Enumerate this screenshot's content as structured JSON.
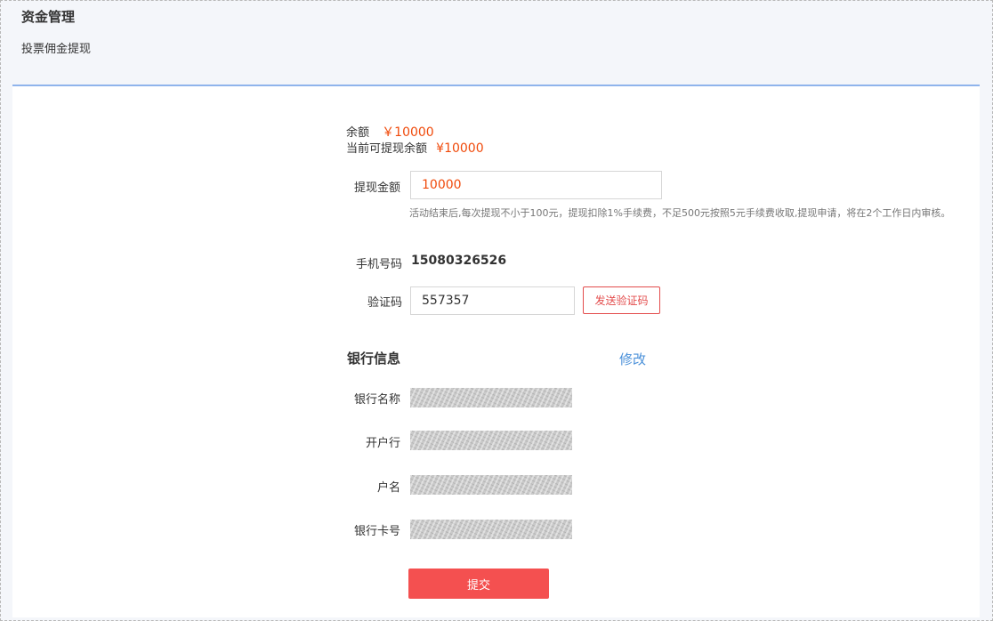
{
  "header": {
    "title": "资金管理",
    "subtitle": "投票佣金提现"
  },
  "balance": {
    "label": "余额",
    "value": "￥10000"
  },
  "available": {
    "label": "当前可提现余额",
    "value": "¥10000"
  },
  "withdraw": {
    "label": "提现金额",
    "value": "10000",
    "hint": "活动结束后,每次提现不小于100元，提现扣除1%手续费，不足500元按照5元手续费收取,提现申请，将在2个工作日内审核。"
  },
  "phone": {
    "label": "手机号码",
    "value": "15080326526"
  },
  "code": {
    "label": "验证码",
    "value": "557357",
    "send_label": "发送验证码"
  },
  "bank": {
    "section_title": "银行信息",
    "edit_label": "修改",
    "fields": [
      {
        "label": "银行名称"
      },
      {
        "label": "开户行"
      },
      {
        "label": "户名"
      },
      {
        "label": "银行卡号"
      }
    ]
  },
  "submit_label": "提交",
  "colors": {
    "accent_red": "#f04a0b",
    "button_red": "#f45050",
    "link_blue": "#4a90d9",
    "header_line": "#8fb4ec"
  }
}
